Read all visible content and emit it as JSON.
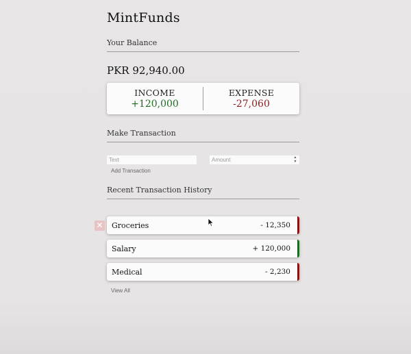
{
  "app": {
    "title": "MintFunds"
  },
  "balance_section": {
    "heading": "Your Balance",
    "amount": "PKR 92,940.00"
  },
  "summary": {
    "income_label": "INCOME",
    "income_value": "+120,000",
    "expense_label": "EXPENSE",
    "expense_value": "-27,060"
  },
  "transaction_form": {
    "heading": "Make Transaction",
    "text_placeholder": "Text",
    "amount_placeholder": "Amount",
    "add_label": "Add Transaction"
  },
  "history": {
    "heading": "Recent Transaction History",
    "items": [
      {
        "name": "Groceries",
        "amount": "- 12,350",
        "type": "expense"
      },
      {
        "name": "Salary",
        "amount": "+ 120,000",
        "type": "income"
      },
      {
        "name": "Medical",
        "amount": "- 2,230",
        "type": "expense"
      }
    ],
    "view_all_label": "View All"
  },
  "icons": {
    "delete": "close-icon",
    "stepper": "stepper-arrows-icon",
    "cursor": "mouse-cursor-icon"
  },
  "colors": {
    "income": "#1d6a22",
    "expense": "#8a1414",
    "background": "#e7e5e5"
  }
}
